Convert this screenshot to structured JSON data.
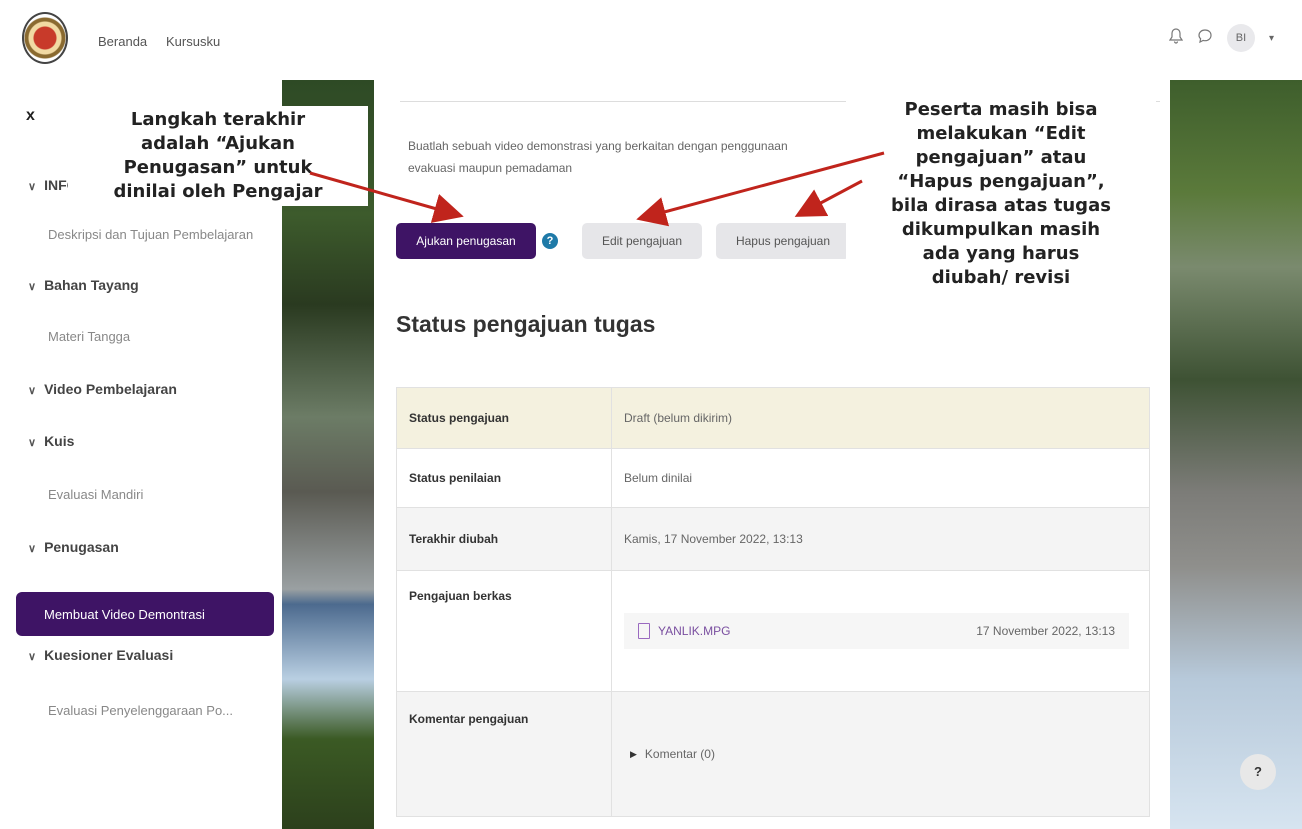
{
  "topbar": {
    "nav": [
      "Beranda",
      "Kursusku"
    ],
    "avatar_initials": "BI",
    "icons": [
      "bell-icon",
      "chat-icon",
      "caret-down-icon"
    ]
  },
  "sidebar": {
    "close_label": "x",
    "sections": [
      {
        "label": "INFO",
        "items": [
          "Deskripsi dan Tujuan Pembelajaran"
        ]
      },
      {
        "label": "Bahan Tayang",
        "items": [
          "Materi Tangga"
        ]
      },
      {
        "label": "Video Pembelajaran",
        "items": []
      },
      {
        "label": "Kuis",
        "items": [
          "Evaluasi Mandiri"
        ]
      },
      {
        "label": "Penugasan",
        "items": [
          "Membuat Video Demontrasi"
        ]
      },
      {
        "label": "Kuesioner Evaluasi",
        "items": [
          "Evaluasi Penyelenggaraan Po..."
        ]
      }
    ],
    "active_item": "Membuat Video Demontrasi"
  },
  "main": {
    "description_line1": "Buatlah sebuah video demonstrasi yang berkaitan dengan penggunaan",
    "description_line2": "evakuasi maupun pemadaman",
    "buttons": {
      "submit": "Ajukan penugasan",
      "edit": "Edit pengajuan",
      "delete": "Hapus pengajuan"
    },
    "heading": "Status pengajuan tugas",
    "table": {
      "status_label": "Status pengajuan",
      "status_value": "Draft (belum dikirim)",
      "grading_label": "Status penilaian",
      "grading_value": "Belum dinilai",
      "modified_label": "Terakhir diubah",
      "modified_value": "Kamis, 17 November 2022, 13:13",
      "file_label": "Pengajuan berkas",
      "file_name": "YANLIK.MPG",
      "file_date": "17 November 2022, 13:13",
      "comment_label": "Komentar pengajuan",
      "comment_link": "Komentar (0)"
    }
  },
  "help_button": "?",
  "annotations": {
    "left": "Langkah terakhir\nadalah “Ajukan\nPenugasan” untuk\ndinilai oleh Pengajar",
    "right": "Peserta masih bisa\nmelakukan “Edit\npengajuan” atau\n“Hapus pengajuan”,\nbila dirasa atas tugas\ndikumpulkan masih\nada yang harus\ndiubah/ revisi"
  },
  "colors": {
    "primary": "#3e1465",
    "draft_row": "#f4f1df",
    "arrow": "#c0241c",
    "help_icon": "#1f7aa8"
  }
}
